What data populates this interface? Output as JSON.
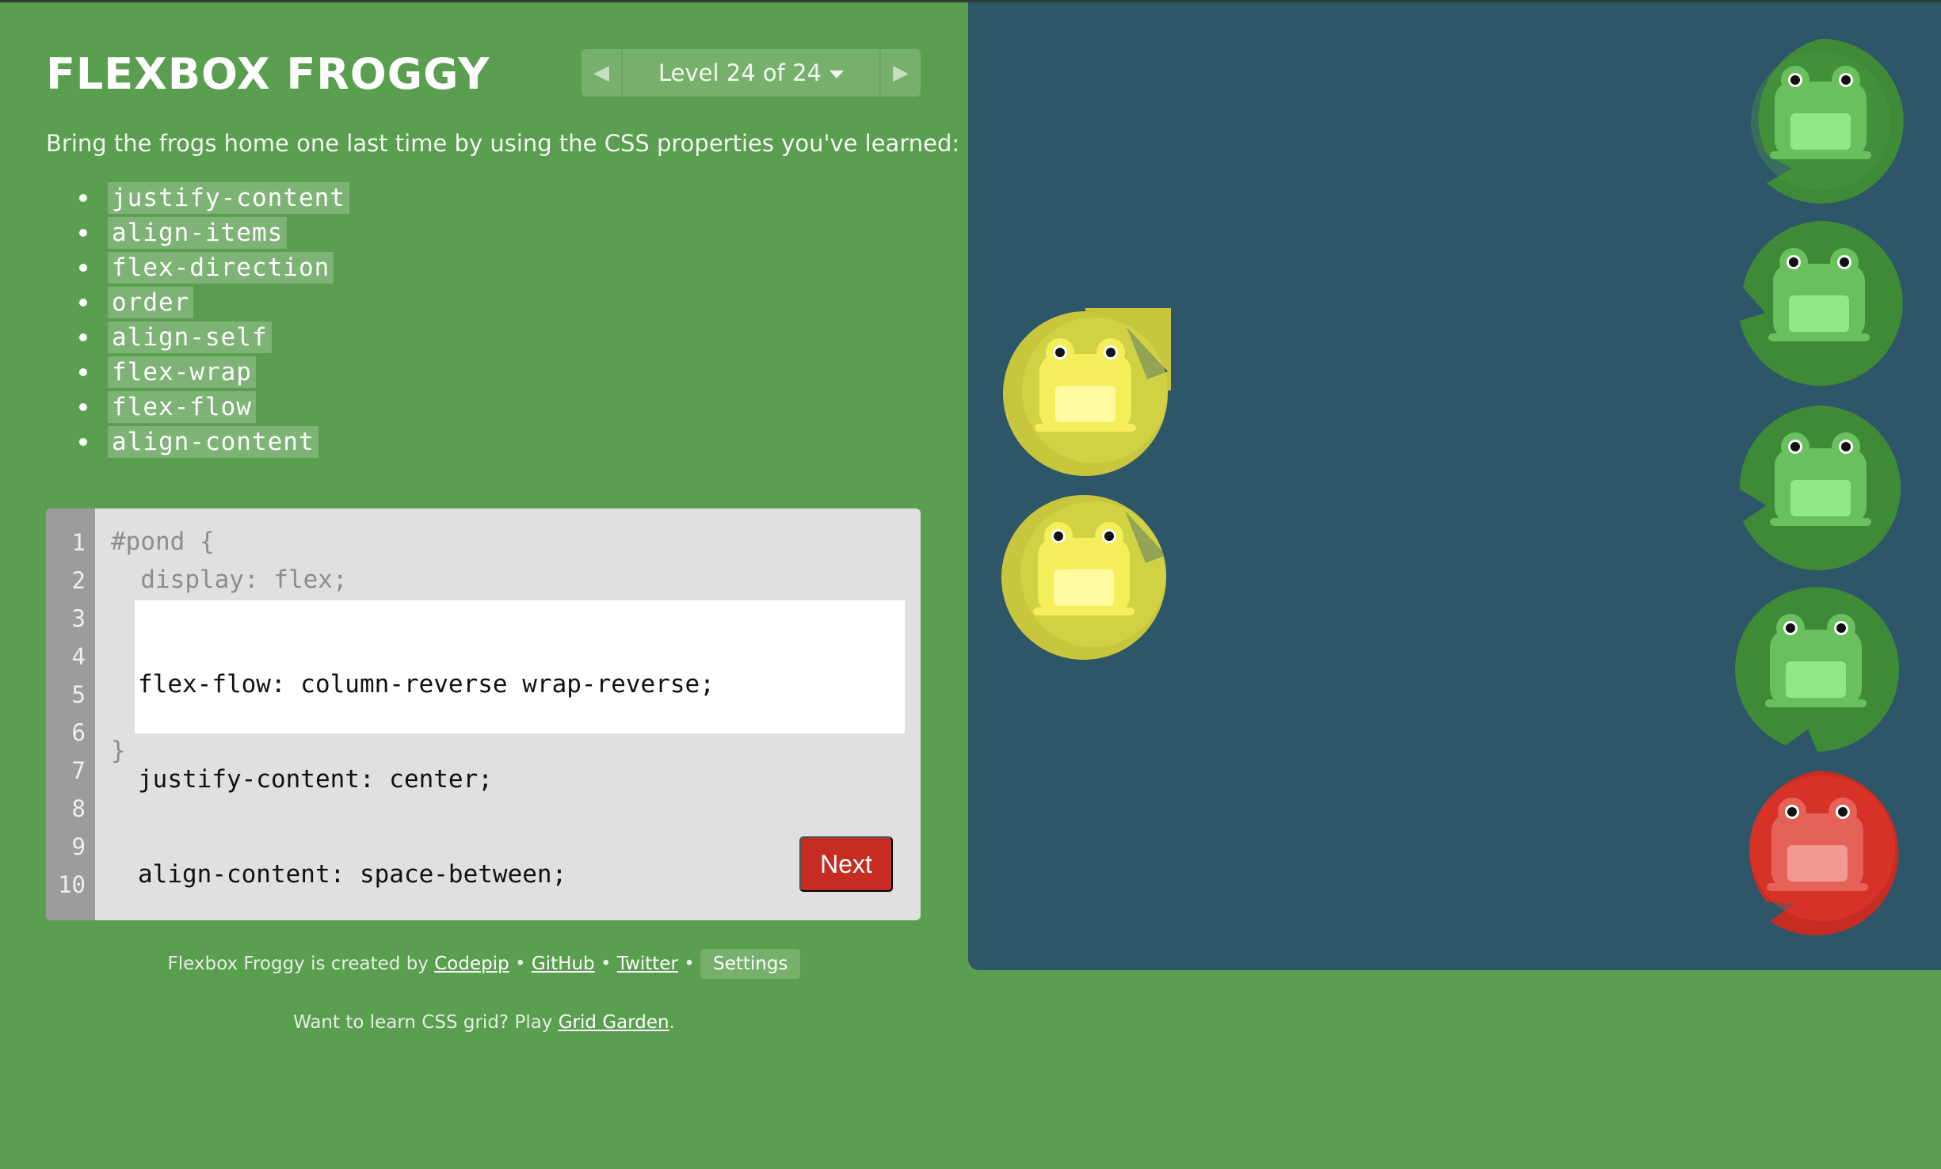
{
  "app": {
    "title": "FLEXBOX FROGGY"
  },
  "level_nav": {
    "prev_icon": "triangle-left",
    "next_icon": "triangle-right",
    "label": "Level 24 of 24"
  },
  "instructions": "Bring the frogs home one last time by using the CSS properties you've learned:",
  "properties": [
    "justify-content",
    "align-items",
    "flex-direction",
    "order",
    "align-self",
    "flex-wrap",
    "flex-flow",
    "align-content"
  ],
  "editor": {
    "line_numbers": [
      "1",
      "2",
      "3",
      "4",
      "5",
      "6",
      "7",
      "8",
      "9",
      "10"
    ],
    "line1": "#pond {",
    "line2": "  display: flex;",
    "input_lines": [
      "flex-flow: column-reverse wrap-reverse;",
      "justify-content: center;",
      "align-content: space-between;"
    ],
    "closing": "}",
    "next_label": "Next"
  },
  "footer": {
    "created_by": "Flexbox Froggy is created by",
    "codepip": "Codepip",
    "github": "GitHub",
    "twitter": "Twitter",
    "sep": "•",
    "settings": "Settings",
    "learn_prefix": "Want to learn CSS grid? Play",
    "grid_garden": "Grid Garden",
    "learn_suffix": "."
  },
  "colors": {
    "background": "#5a9e50",
    "pond": "#2d5668",
    "green_pad": "#3f8a36",
    "yellow_frog": "#f4ee5a",
    "red_pad": "#c72c22",
    "next_button": "#c72c22"
  },
  "pond_items": [
    {
      "type": "lilypad",
      "color": "green"
    },
    {
      "type": "lilypad",
      "color": "green"
    },
    {
      "type": "lilypad",
      "color": "green"
    },
    {
      "type": "lilypad",
      "color": "green"
    },
    {
      "type": "lilypad",
      "color": "red"
    },
    {
      "type": "frog",
      "color": "yellow"
    },
    {
      "type": "frog",
      "color": "yellow"
    }
  ]
}
